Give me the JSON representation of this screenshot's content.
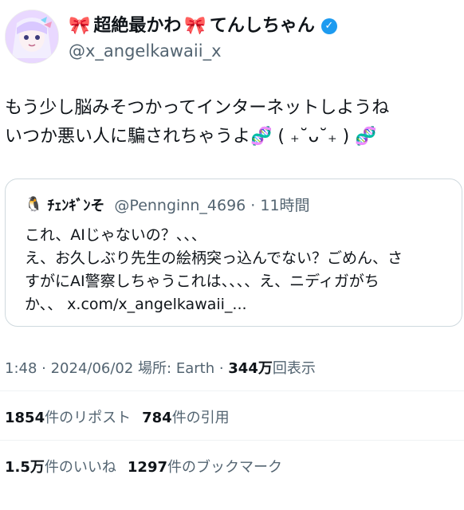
{
  "author": {
    "display_name": "超絶最かわ",
    "display_name_2": "てんしちゃん",
    "handle": "@x_angelkawaii_x"
  },
  "tweet": {
    "text": "もう少し脳みそつかってインターネットしようね\nいつか悪い人に騙されちゃうよ🧬 ( ₊˘ᴗ˘₊ ) 🧬"
  },
  "quote": {
    "name": "ﾁｪﾝｷﾞﾝそ",
    "handle_time": "@Pennginn_4696 · 11時間",
    "text": "これ、AIじゃないの？、、、\nえ、お久しぶり先生の絵柄突っ込んでない？ごめん、さ\nすがにAI警察しちゃうこれは、、、、え、ニディガがち\nか、、 x.com/x_angelkawaii_..."
  },
  "meta": {
    "time_date_place": "1:48 · 2024/06/02 場所: Earth · ",
    "views_count": "344万",
    "views_label": "回表示"
  },
  "stats": {
    "reposts_count": "1854",
    "reposts_label": "件のリポスト",
    "quotes_count": "784",
    "quotes_label": "件の引用",
    "likes_count": "1.5万",
    "likes_label": "件のいいね",
    "bookmarks_count": "1297",
    "bookmarks_label": "件のブックマーク"
  },
  "colors": {
    "text": "#0f1419",
    "secondary": "#536471",
    "verified": "#1d9bf0",
    "border": "#cfd9de"
  },
  "icons": [
    "ribbon-icon",
    "verified-badge-icon",
    "penguin-icon"
  ]
}
